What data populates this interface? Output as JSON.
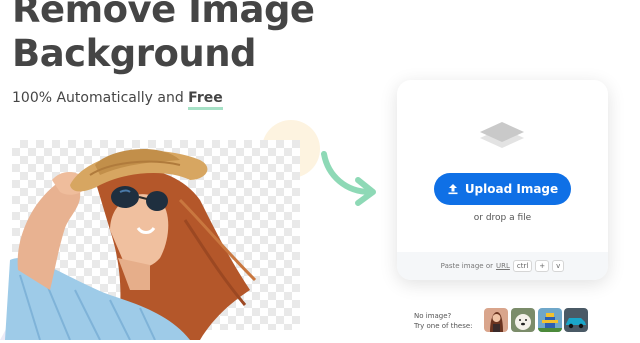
{
  "headline": {
    "line1": "Remove Image",
    "line2": "Background"
  },
  "subtitle": {
    "prefix": "100% Automatically and",
    "emphasis": "Free"
  },
  "upload": {
    "button_label": "Upload Image",
    "drop_text": "or drop a file",
    "paste_prefix": "Paste image or",
    "paste_url": "URL",
    "kbd_ctrl": "ctrl",
    "kbd_plus": "+",
    "kbd_v": "v"
  },
  "samples": {
    "line1": "No image?",
    "line2": "Try one of these:"
  },
  "colors": {
    "button": "#0f70e6",
    "accent_green": "#a6e1c6",
    "text": "#454545"
  },
  "icons": [
    "upload-icon",
    "layers-icon",
    "curved-arrow-icon"
  ]
}
